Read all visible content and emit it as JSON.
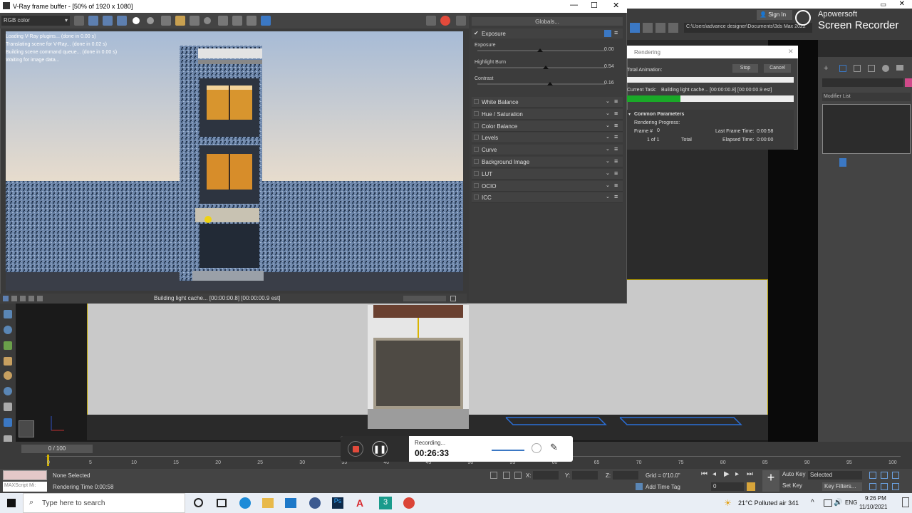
{
  "vfb": {
    "title": "V-Ray frame buffer - [50% of 1920 x 1080]",
    "channel": "RGB color",
    "log_lines": [
      "Loading V-Ray plugins... (done in 0.00 s)",
      "Translating scene for V-Ray... (done in 0.02 s)",
      "Building scene command queue... (done in 0.00 s)",
      "Waiting for image data..."
    ],
    "status": "Building light cache... [00:00:00.8] [00:00:00.9 est]",
    "globals_label": "Globals...",
    "exposure": {
      "title": "Exposure",
      "rows": [
        {
          "label": "Exposure",
          "value": "0.00"
        },
        {
          "label": "Highlight Burn",
          "value": "0.54"
        },
        {
          "label": "Contrast",
          "value": "0.16"
        }
      ]
    },
    "layers": [
      "White Balance",
      "Hue / Saturation",
      "Color Balance",
      "Levels",
      "Curve",
      "Background Image",
      "LUT",
      "OCIO",
      "ICC"
    ]
  },
  "max": {
    "sign_in": "Sign In",
    "path": "C:\\Users\\advance designer\\Documents\\3ds Max 2022",
    "modifier_list": "Modifier List",
    "frame_counter": "0 / 100",
    "timeline_ticks": [
      "0",
      "5",
      "10",
      "15",
      "20",
      "25",
      "30",
      "35",
      "40",
      "45",
      "50",
      "55",
      "60",
      "65",
      "70",
      "75",
      "80",
      "85",
      "90",
      "95",
      "100"
    ],
    "status_selected": "None Selected",
    "rendering_time": "Rendering Time  0:00:58",
    "maxscript": "MAXScript Mi:",
    "x_label": "X:",
    "y_label": "Y:",
    "z_label": "Z:",
    "grid": "Grid = 0'10.0\"",
    "add_time_tag": "Add Time Tag",
    "auto_key": "Auto Key",
    "set_key": "Set Key",
    "selected": "Selected",
    "key_filters": "Key Filters...",
    "frame_field": "0"
  },
  "render_dialog": {
    "title": "Rendering",
    "total_animation": "Total Animation:",
    "stop": "Stop",
    "cancel": "Cancel",
    "current_task_label": "Current Task:",
    "current_task": "Building light cache... [00:00:00.8] [00:00:00.9 est]",
    "progress": 0.32,
    "common_params": "Common Parameters",
    "rendering_progress": "Rendering Progress:",
    "frame_label": "Frame #",
    "frame_value": "0",
    "last_frame_time_label": "Last Frame Time:",
    "last_frame_time": "0:00:58",
    "of_label": "1 of 1",
    "total_label": "Total",
    "elapsed_label": "Elapsed Time:",
    "elapsed": "0:00:00"
  },
  "recorder": {
    "label": "Recording...",
    "time": "00:26:33"
  },
  "watermark": {
    "line1": "Apowersoft",
    "line2": "Screen Recorder"
  },
  "taskbar": {
    "search_placeholder": "Type here to search",
    "weather": "21°C  Polluted air 341",
    "lang": "ENG",
    "time": "9:26 PM",
    "date": "11/10/2021"
  },
  "colors": {
    "accent_blue": "#3b78c4",
    "progress_green": "#1aa928",
    "record_red": "#e24a3b",
    "selection_yellow": "#b8a000"
  }
}
